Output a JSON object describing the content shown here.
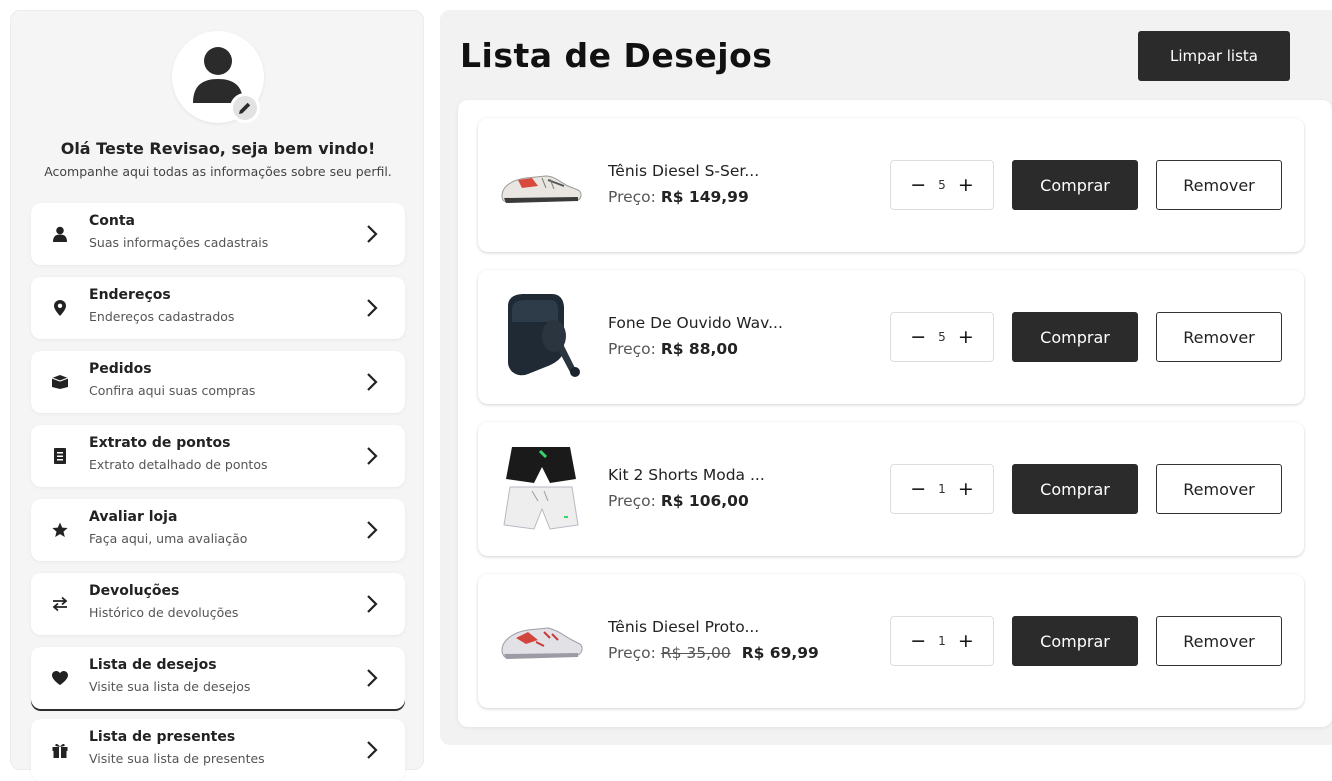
{
  "profile": {
    "greeting": "Olá Teste Revisao, seja bem vindo!",
    "subtitle": "Acompanhe aqui todas as informações sobre seu perfil.",
    "avatar_icon": "user-icon",
    "edit_icon": "pencil-icon"
  },
  "sidebar": {
    "items": [
      {
        "title": "Conta",
        "subtitle": "Suas informações cadastrais",
        "icon": "user-icon"
      },
      {
        "title": "Endereços",
        "subtitle": "Endereços cadastrados",
        "icon": "map-pin-icon"
      },
      {
        "title": "Pedidos",
        "subtitle": "Confira aqui suas compras",
        "icon": "box-icon"
      },
      {
        "title": "Extrato de pontos",
        "subtitle": "Extrato detalhado de pontos",
        "icon": "receipt-icon"
      },
      {
        "title": "Avaliar loja",
        "subtitle": "Faça aqui, uma avaliação",
        "icon": "star-icon"
      },
      {
        "title": "Devoluções",
        "subtitle": "Histórico de devoluções",
        "icon": "exchange-icon"
      },
      {
        "title": "Lista de desejos",
        "subtitle": "Visite sua lista de desejos",
        "icon": "heart-icon"
      },
      {
        "title": "Lista de presentes",
        "subtitle": "Visite sua lista de presentes",
        "icon": "gift-icon"
      }
    ],
    "active_item": "Lista de desejos"
  },
  "main": {
    "title": "Lista de Desejos",
    "clear_label": "Limpar lista"
  },
  "products": [
    {
      "name": "Tênis Diesel S-Ser...",
      "price_label": "Preço:",
      "old_price": "",
      "price": "R$ 149,99",
      "qty": "5",
      "image": "sneaker-image"
    },
    {
      "name": "Fone De Ouvido Wav...",
      "price_label": "Preço:",
      "old_price": "",
      "price": "R$ 88,00",
      "qty": "5",
      "image": "earbuds-image"
    },
    {
      "name": "Kit 2 Shorts Moda ...",
      "price_label": "Preço:",
      "old_price": "",
      "price": "R$ 106,00",
      "qty": "1",
      "image": "shorts-image"
    },
    {
      "name": "Tênis Diesel Proto...",
      "price_label": "Preço:",
      "old_price": "R$ 35,00",
      "price": "R$ 69,99",
      "qty": "1",
      "image": "sneaker-image"
    }
  ],
  "labels": {
    "minus": "−",
    "plus": "+",
    "buy": "Comprar",
    "remove": "Remover"
  }
}
